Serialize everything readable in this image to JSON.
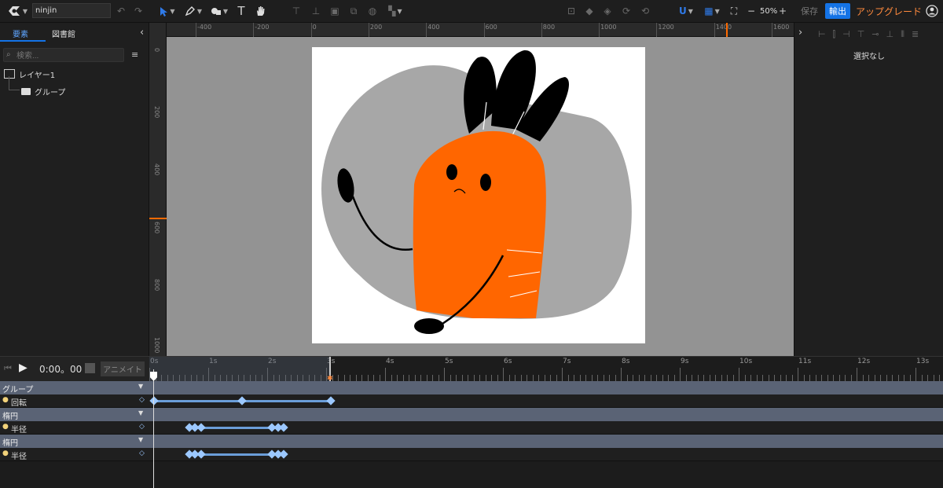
{
  "toolbar": {
    "file_name": "ninjin",
    "zoom_value": "50%",
    "save_label": "保存",
    "export_label": "輸出",
    "upgrade_label": "アップグレード",
    "accent": "#1473e6",
    "upgrade_color": "#ff8a3d"
  },
  "left_panel": {
    "tabs": [
      "要素",
      "図書館"
    ],
    "search_placeholder": "検索...",
    "layers": [
      {
        "label": "レイヤー1",
        "icon": "layer-icon"
      },
      {
        "label": "グループ",
        "icon": "folder-icon"
      }
    ]
  },
  "rulers": {
    "h_labels": [
      "-400",
      "-200",
      "0",
      "200",
      "400",
      "600",
      "800",
      "1000",
      "1200",
      "1400",
      "1600"
    ],
    "v_labels": [
      "0",
      "200",
      "400",
      "600",
      "800",
      "1000"
    ]
  },
  "right_panel": {
    "empty_label": "選択なし"
  },
  "timeline": {
    "timecode": "0:00。00",
    "animate_label": "アニメイト",
    "seconds": [
      "0s",
      "1s",
      "2s",
      "3s",
      "4s",
      "5s",
      "6s",
      "7s",
      "8s",
      "9s",
      "10s",
      "11s",
      "12s",
      "13s"
    ],
    "tracks": [
      {
        "group": "グループ",
        "property": "回転"
      },
      {
        "group": "楕円",
        "property": "半径"
      },
      {
        "group": "楕円",
        "property": "半径"
      }
    ]
  }
}
